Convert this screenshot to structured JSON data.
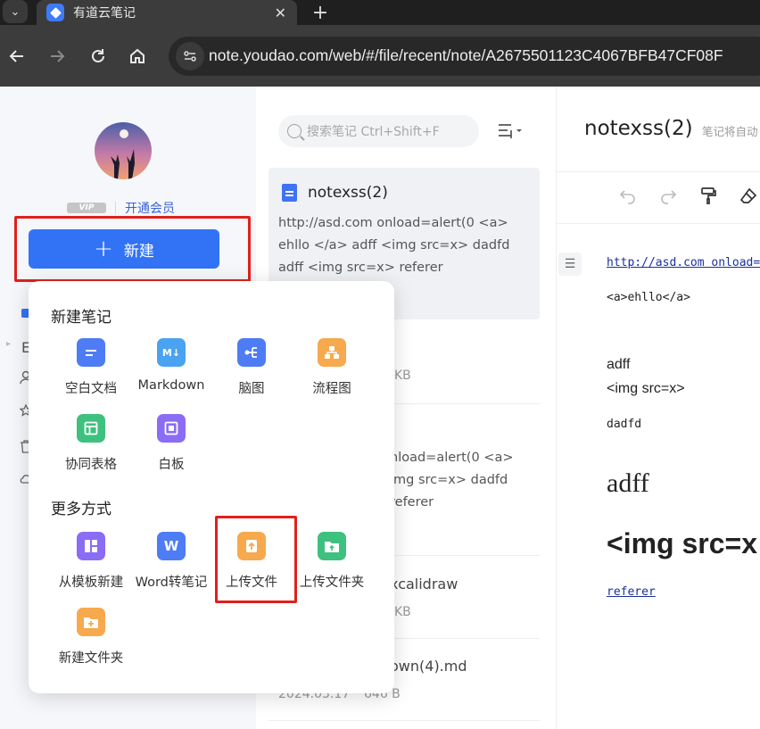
{
  "browser": {
    "tab_title": "有道云笔记",
    "url": "note.youdao.com/web/#/file/recent/note/A2675501123C4067BFB47CF08F"
  },
  "sidebar": {
    "vip_badge": "VIP",
    "vip_link": "开通会员",
    "new_button": "新建",
    "partial_labels": [
      "E"
    ]
  },
  "notelist": {
    "search_placeholder": "搜索笔记 Ctrl+Shift+F",
    "cards": [
      {
        "title": "notexss(2)",
        "snippet": "http://asd.com onload=alert(0 <a> ehllo </a> adff <img src=x> dadfd adff <img src=x> referer"
      }
    ],
    "partial_texts": [
      "x",
      "KB",
      "nload=alert(0 <a>",
      "img src=x> dadfd",
      "referer",
      "xcalidraw",
      "KB",
      "own(4).md",
      "2024.03.17",
      "646 B"
    ]
  },
  "editor": {
    "title": "notexss(2)",
    "hint": "笔记将自动",
    "content": {
      "link1": "http://asd.com onload=",
      "line2": "<a>ehllo</a>",
      "line3": "adff",
      "line4": "<img src=x>",
      "line5": "dadfd",
      "line6": "adff",
      "line7": "<img src=x",
      "link2": "referer"
    }
  },
  "popup": {
    "section1_title": "新建笔记",
    "section1_items": [
      {
        "label": "空白文档",
        "icon": "blank-doc-icon",
        "color": "#4d7cf5"
      },
      {
        "label": "Markdown",
        "icon": "markdown-icon",
        "color": "#4aa3f0"
      },
      {
        "label": "脑图",
        "icon": "mindmap-icon",
        "color": "#4d7cf5"
      },
      {
        "label": "流程图",
        "icon": "flowchart-icon",
        "color": "#f7a94e"
      },
      {
        "label": "协同表格",
        "icon": "table-icon",
        "color": "#3ec17f"
      },
      {
        "label": "白板",
        "icon": "whiteboard-icon",
        "color": "#8a6cf5"
      }
    ],
    "section2_title": "更多方式",
    "section2_items": [
      {
        "label": "从模板新建",
        "icon": "template-icon",
        "color": "#8a6cf5"
      },
      {
        "label": "Word转笔记",
        "icon": "word-icon",
        "color": "#4d7cf5"
      },
      {
        "label": "上传文件",
        "icon": "upload-file-icon",
        "color": "#f7a94e"
      },
      {
        "label": "上传文件夹",
        "icon": "upload-folder-icon",
        "color": "#3ec17f"
      },
      {
        "label": "新建文件夹",
        "icon": "new-folder-icon",
        "color": "#f7a94e"
      }
    ]
  },
  "colors": {
    "accent": "#3273f6",
    "highlight": "#e0201b"
  }
}
